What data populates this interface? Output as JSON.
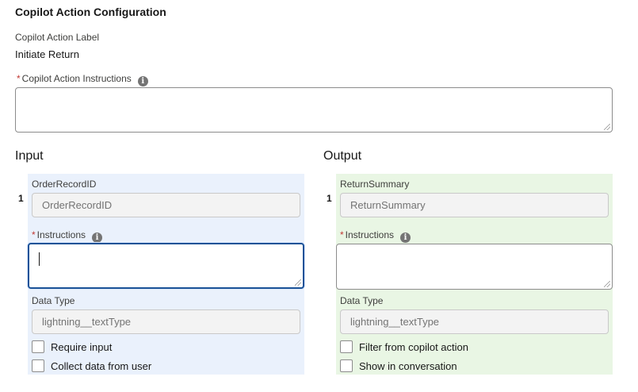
{
  "header": {
    "title": "Copilot Action Configuration"
  },
  "action_label": {
    "label": "Copilot Action Label",
    "value": "Initiate Return"
  },
  "action_instructions": {
    "required_mark": "*",
    "label": "Copilot Action Instructions",
    "value": ""
  },
  "info_icon_glyph": "i",
  "input": {
    "section_title": "Input",
    "row_number": "1",
    "field_label": "OrderRecordID",
    "field_value": "OrderRecordID",
    "instructions_required_mark": "*",
    "instructions_label": "Instructions",
    "instructions_value": "",
    "data_type_label": "Data Type",
    "data_type_value": "lightning__textType",
    "checkbox_1": "Require input",
    "checkbox_2": "Collect data from user",
    "background_color": "#eaf1fc"
  },
  "output": {
    "section_title": "Output",
    "row_number": "1",
    "field_label": "ReturnSummary",
    "field_value": "ReturnSummary",
    "instructions_required_mark": "*",
    "instructions_label": "Instructions",
    "instructions_value": "",
    "data_type_label": "Data Type",
    "data_type_value": "lightning__textType",
    "checkbox_1": "Filter from copilot action",
    "checkbox_2": "Show in conversation",
    "background_color": "#e9f6e4"
  },
  "colors": {
    "required": "#c23934",
    "focus_border": "#1b5297"
  }
}
